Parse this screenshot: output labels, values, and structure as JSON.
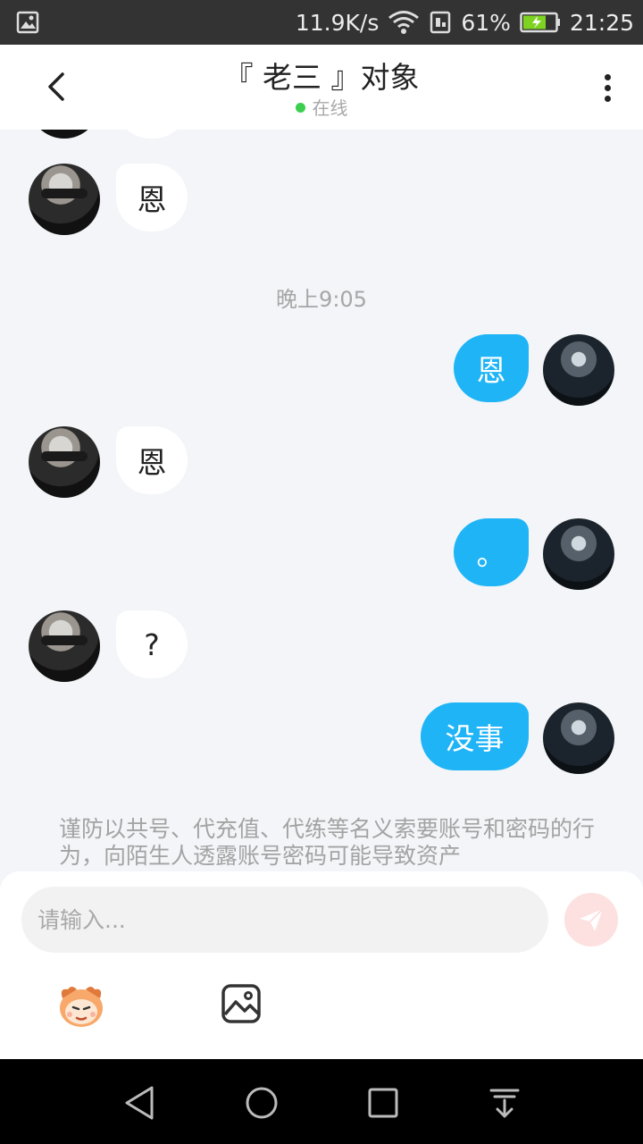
{
  "status_bar": {
    "speed": "11.9K/s",
    "battery_percent": "61%",
    "time": "21:25",
    "icons": [
      "image-notification-icon",
      "wifi-icon",
      "sim-icon",
      "battery-icon"
    ]
  },
  "header": {
    "title": "『 老三 』对象",
    "status": "在线",
    "status_color": "#3ccf4e"
  },
  "messages": {
    "m1_text": "恩",
    "time_1": "晚上9:05",
    "m2_text": "恩",
    "m3_text": "恩",
    "m4_text": "。",
    "m5_text": "?",
    "m6_text": "没事"
  },
  "warning": {
    "text": "谨防以共号、代充值、代练等名义索要账号和密码的行为，向陌生人透露账号密码可能导致资产"
  },
  "composer": {
    "placeholder": "请输入..."
  },
  "colors": {
    "accent": "#1fb4f6",
    "background": "#f3f5f8",
    "send_inactive": "#fde0e0"
  }
}
